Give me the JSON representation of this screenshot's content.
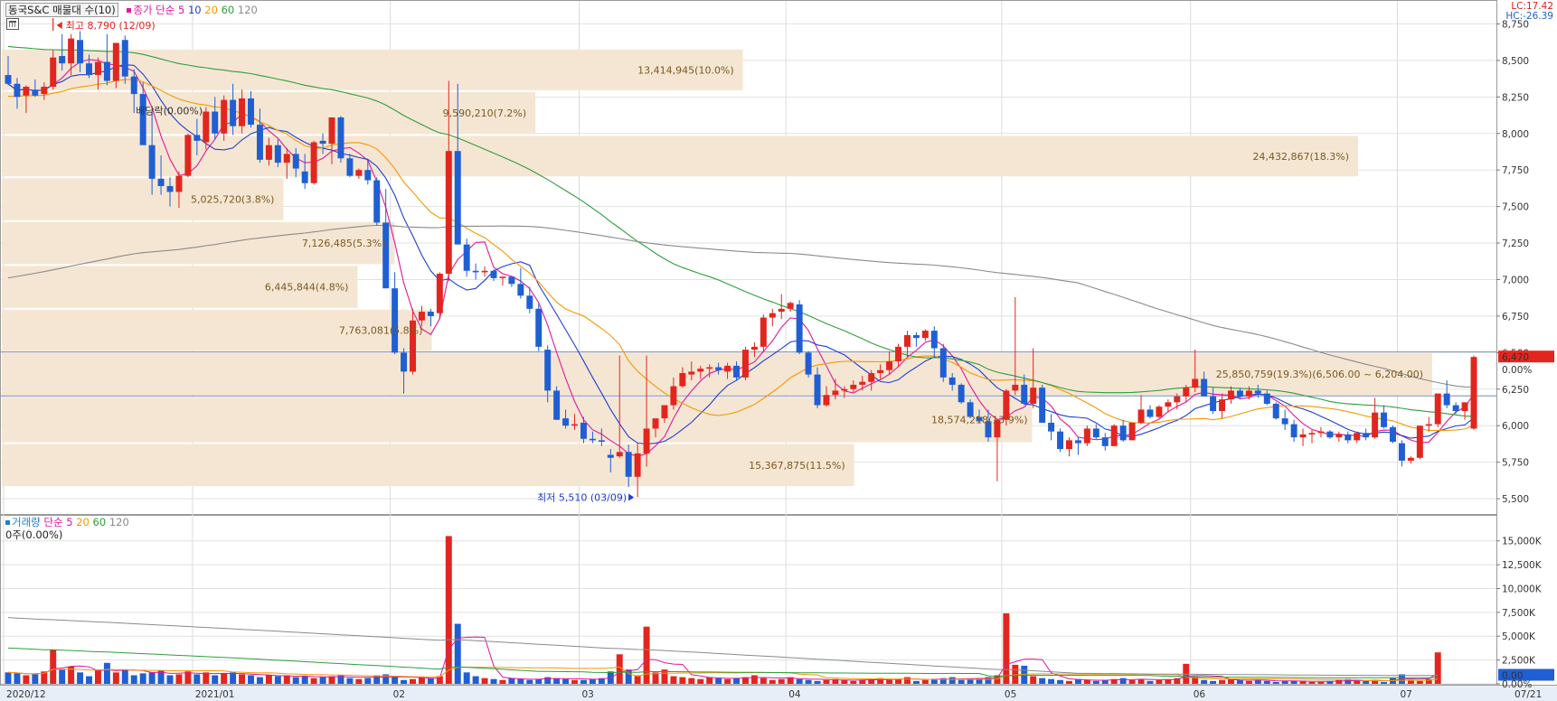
{
  "chart_data": [
    {
      "type": "candlestick",
      "title": "동국S&C 매물대 수(10)",
      "legend_ma": {
        "prefix": "종가 단순",
        "items": [
          {
            "period": "5",
            "color": "#e0179c"
          },
          {
            "period": "10",
            "color": "#1f3fd1"
          },
          {
            "period": "20",
            "color": "#f29a00"
          },
          {
            "period": "60",
            "color": "#2e9e3e"
          },
          {
            "period": "120",
            "color": "#8a8a8a"
          }
        ]
      },
      "corner_labels": {
        "lc": "LC:17.42",
        "hc": "HC:-26.39"
      },
      "ylim": [
        5420,
        8790
      ],
      "yticks": [
        "5,500",
        "5,750",
        "6,000",
        "6,250",
        "6,500",
        "6,750",
        "7,000",
        "7,250",
        "7,500",
        "7,750",
        "8,000",
        "8,250",
        "8,500",
        "8,750"
      ],
      "ytick_values": [
        5500,
        5750,
        6000,
        6250,
        6500,
        6750,
        7000,
        7250,
        7500,
        7750,
        8000,
        8250,
        8500,
        8750
      ],
      "price_tag": "6,470",
      "price_tag_pct": "0.00%",
      "high_label": "최고 8,790 (12/09)",
      "low_label": "최저 5,510 (03/09)",
      "ex_div_label": "배당락(0.00%)",
      "volume_profile": [
        {
          "label": "15,367,875(11.5%)",
          "lo": 5580,
          "hi": 5880,
          "pct": 11.5
        },
        {
          "label": "25,850,759(19.3%)(6,506.00 ~ 6,204.00)",
          "lo": 6204,
          "hi": 6506,
          "pct": 19.3
        },
        {
          "label": "",
          "lo": 5880,
          "hi": 6204,
          "pct": 13.9
        },
        {
          "label": "7,763,081(5.8%)",
          "lo": 6506,
          "hi": 6800,
          "pct": 5.8
        },
        {
          "label": "6,445,844(4.8%)",
          "lo": 6800,
          "hi": 7100,
          "pct": 4.8
        },
        {
          "label": "7,126,485(5.3%)",
          "lo": 7100,
          "hi": 7400,
          "pct": 5.3
        },
        {
          "label": "5,025,720(3.8%)",
          "lo": 7400,
          "hi": 7700,
          "pct": 3.8
        },
        {
          "label": "24,432,867(18.3%)",
          "lo": 7700,
          "hi": 7990,
          "pct": 18.3
        },
        {
          "label": "9,590,210(7.2%)",
          "lo": 7990,
          "hi": 8290,
          "pct": 7.2
        },
        {
          "label": "13,414,945(10.0%)",
          "lo": 8290,
          "hi": 8580,
          "pct": 10.0
        }
      ],
      "profile_mid_label": "18,574,218(13.9%)",
      "hlines": [
        6506,
        6204
      ],
      "series_candles": [
        [
          8400,
          8530,
          8330,
          8340
        ],
        [
          8340,
          8380,
          8170,
          8250
        ],
        [
          8260,
          8330,
          8140,
          8320
        ],
        [
          8300,
          8370,
          8250,
          8260
        ],
        [
          8270,
          8350,
          8230,
          8320
        ],
        [
          8320,
          8570,
          8300,
          8520
        ],
        [
          8530,
          8680,
          8430,
          8480
        ],
        [
          8480,
          8680,
          8400,
          8650
        ],
        [
          8640,
          8700,
          8420,
          8480
        ],
        [
          8480,
          8540,
          8380,
          8400
        ],
        [
          8400,
          8520,
          8300,
          8490
        ],
        [
          8490,
          8680,
          8330,
          8360
        ],
        [
          8360,
          8560,
          8310,
          8620
        ],
        [
          8640,
          8670,
          8340,
          8390
        ],
        [
          8390,
          8440,
          8140,
          8270
        ],
        [
          8270,
          8350,
          8050,
          7920
        ],
        [
          7920,
          8160,
          7580,
          7690
        ],
        [
          7690,
          7850,
          7580,
          7640
        ],
        [
          7640,
          7700,
          7500,
          7600
        ],
        [
          7600,
          7740,
          7490,
          7710
        ],
        [
          7710,
          8000,
          7700,
          7990
        ],
        [
          7990,
          8100,
          7850,
          7950
        ],
        [
          7940,
          8180,
          7890,
          8150
        ],
        [
          8150,
          8250,
          7960,
          8000
        ],
        [
          8000,
          8260,
          7950,
          8230
        ],
        [
          8230,
          8340,
          7990,
          8050
        ],
        [
          8050,
          8300,
          8000,
          8240
        ],
        [
          8240,
          8290,
          8040,
          8060
        ],
        [
          8060,
          8170,
          7800,
          7820
        ],
        [
          7820,
          7970,
          7780,
          7920
        ],
        [
          7920,
          7960,
          7770,
          7800
        ],
        [
          7800,
          7900,
          7690,
          7860
        ],
        [
          7860,
          7900,
          7700,
          7760
        ],
        [
          7740,
          7860,
          7620,
          7660
        ],
        [
          7660,
          7950,
          7650,
          7940
        ],
        [
          7950,
          8000,
          7860,
          7930
        ],
        [
          7930,
          8110,
          7790,
          8110
        ],
        [
          8110,
          8120,
          7800,
          7830
        ],
        [
          7830,
          7860,
          7700,
          7710
        ],
        [
          7710,
          7760,
          7690,
          7750
        ],
        [
          7750,
          7820,
          7650,
          7680
        ],
        [
          7680,
          7700,
          7370,
          7390
        ],
        [
          7390,
          7620,
          6940,
          6940
        ],
        [
          6940,
          7050,
          6490,
          6500
        ],
        [
          6500,
          6530,
          6220,
          6370
        ],
        [
          6370,
          6800,
          6350,
          6720
        ],
        [
          6720,
          6820,
          6680,
          6780
        ],
        [
          6780,
          6800,
          6680,
          6750
        ],
        [
          6770,
          7050,
          6730,
          7040
        ],
        [
          7040,
          8360,
          6990,
          7880
        ],
        [
          7880,
          8340,
          7520,
          7240
        ],
        [
          7240,
          7280,
          7020,
          7060
        ],
        [
          7060,
          7110,
          7000,
          7050
        ],
        [
          7050,
          7090,
          7020,
          7060
        ],
        [
          7060,
          7070,
          6990,
          7010
        ],
        [
          7010,
          7020,
          6960,
          7020
        ],
        [
          7020,
          7020,
          6950,
          6970
        ],
        [
          6970,
          7080,
          6870,
          6890
        ],
        [
          6890,
          6950,
          6770,
          6800
        ],
        [
          6800,
          6840,
          6510,
          6540
        ],
        [
          6520,
          6550,
          6160,
          6240
        ],
        [
          6240,
          6270,
          6040,
          6040
        ],
        [
          6050,
          6110,
          5980,
          6000
        ],
        [
          6000,
          6080,
          5970,
          6010
        ],
        [
          6020,
          6060,
          5880,
          5910
        ],
        [
          5910,
          5960,
          5880,
          5900
        ],
        [
          5900,
          5980,
          5860,
          5890
        ],
        [
          5800,
          5840,
          5680,
          5780
        ],
        [
          5790,
          6480,
          5780,
          5820
        ],
        [
          5820,
          5870,
          5580,
          5650
        ],
        [
          5650,
          5880,
          5510,
          5810
        ],
        [
          5810,
          6480,
          5720,
          5980
        ],
        [
          5980,
          6040,
          5920,
          6050
        ],
        [
          6050,
          6130,
          6020,
          6140
        ],
        [
          6140,
          6330,
          6110,
          6270
        ],
        [
          6270,
          6400,
          6260,
          6360
        ],
        [
          6350,
          6440,
          6310,
          6370
        ],
        [
          6370,
          6410,
          6320,
          6390
        ],
        [
          6390,
          6420,
          6330,
          6400
        ],
        [
          6400,
          6430,
          6350,
          6380
        ],
        [
          6370,
          6430,
          6320,
          6410
        ],
        [
          6410,
          6440,
          6310,
          6330
        ],
        [
          6330,
          6540,
          6310,
          6520
        ],
        [
          6520,
          6570,
          6470,
          6540
        ],
        [
          6540,
          6760,
          6510,
          6740
        ],
        [
          6740,
          6800,
          6680,
          6770
        ],
        [
          6780,
          6900,
          6730,
          6800
        ],
        [
          6800,
          6850,
          6780,
          6840
        ],
        [
          6830,
          6860,
          6490,
          6500
        ],
        [
          6500,
          6510,
          6330,
          6350
        ],
        [
          6350,
          6400,
          6120,
          6140
        ],
        [
          6140,
          6270,
          6130,
          6210
        ],
        [
          6210,
          6320,
          6180,
          6240
        ],
        [
          6240,
          6270,
          6190,
          6250
        ],
        [
          6250,
          6310,
          6230,
          6280
        ],
        [
          6280,
          6340,
          6240,
          6300
        ],
        [
          6300,
          6380,
          6240,
          6360
        ],
        [
          6360,
          6420,
          6320,
          6380
        ],
        [
          6380,
          6510,
          6350,
          6440
        ],
        [
          6440,
          6560,
          6400,
          6540
        ],
        [
          6540,
          6650,
          6470,
          6620
        ],
        [
          6620,
          6640,
          6540,
          6600
        ],
        [
          6600,
          6660,
          6580,
          6650
        ],
        [
          6650,
          6680,
          6470,
          6530
        ],
        [
          6530,
          6560,
          6300,
          6330
        ],
        [
          6330,
          6360,
          6240,
          6280
        ],
        [
          6280,
          6290,
          6150,
          6160
        ],
        [
          6160,
          6180,
          6050,
          6060
        ],
        [
          6060,
          6110,
          6020,
          6030
        ],
        [
          6030,
          6110,
          5890,
          5920
        ],
        [
          5920,
          5940,
          5620,
          6040
        ],
        [
          6040,
          6250,
          6000,
          6240
        ],
        [
          6240,
          6880,
          6210,
          6280
        ],
        [
          6280,
          6350,
          6140,
          6150
        ],
        [
          6150,
          6530,
          6120,
          6260
        ],
        [
          6260,
          6280,
          6020,
          6020
        ],
        [
          6020,
          6080,
          5900,
          5960
        ],
        [
          5960,
          5980,
          5820,
          5840
        ],
        [
          5840,
          5920,
          5790,
          5900
        ],
        [
          5900,
          5920,
          5800,
          5880
        ],
        [
          5880,
          6000,
          5860,
          5980
        ],
        [
          5980,
          6010,
          5910,
          5920
        ],
        [
          5920,
          5950,
          5830,
          5860
        ],
        [
          5860,
          6010,
          5860,
          6000
        ],
        [
          6000,
          6040,
          5890,
          5900
        ],
        [
          5900,
          6020,
          5900,
          6020
        ],
        [
          6020,
          6210,
          6010,
          6110
        ],
        [
          6110,
          6140,
          6050,
          6060
        ],
        [
          6060,
          6140,
          6050,
          6130
        ],
        [
          6130,
          6180,
          6090,
          6160
        ],
        [
          6160,
          6220,
          6110,
          6200
        ],
        [
          6200,
          6280,
          6160,
          6260
        ],
        [
          6260,
          6520,
          6230,
          6320
        ],
        [
          6320,
          6370,
          6200,
          6200
        ],
        [
          6200,
          6260,
          6080,
          6100
        ],
        [
          6100,
          6220,
          6050,
          6180
        ],
        [
          6180,
          6270,
          6150,
          6240
        ],
        [
          6240,
          6260,
          6180,
          6200
        ],
        [
          6200,
          6270,
          6180,
          6240
        ],
        [
          6240,
          6280,
          6190,
          6220
        ],
        [
          6220,
          6240,
          6140,
          6150
        ],
        [
          6150,
          6160,
          6040,
          6050
        ],
        [
          6050,
          6110,
          5970,
          6010
        ],
        [
          6010,
          6040,
          5890,
          5920
        ],
        [
          5920,
          5980,
          5860,
          5940
        ],
        [
          5940,
          5970,
          5880,
          5950
        ],
        [
          5950,
          5990,
          5920,
          5960
        ],
        [
          5960,
          5970,
          5910,
          5920
        ],
        [
          5920,
          5960,
          5890,
          5940
        ],
        [
          5940,
          5960,
          5880,
          5900
        ],
        [
          5900,
          5960,
          5880,
          5950
        ],
        [
          5950,
          5980,
          5900,
          5920
        ],
        [
          5920,
          6190,
          5910,
          6090
        ],
        [
          6090,
          6140,
          5980,
          5990
        ],
        [
          5990,
          6000,
          5880,
          5890
        ],
        [
          5880,
          5900,
          5720,
          5760
        ],
        [
          5760,
          5790,
          5740,
          5780
        ],
        [
          5780,
          5990,
          5770,
          6000
        ],
        [
          6000,
          6060,
          5960,
          6010
        ],
        [
          6010,
          6090,
          5990,
          6220
        ],
        [
          6220,
          6310,
          6120,
          6140
        ],
        [
          6140,
          6160,
          6080,
          6100
        ],
        [
          6100,
          6120,
          6040,
          6160
        ],
        [
          5980,
          6480,
          5970,
          6470
        ]
      ],
      "volume_ylim": [
        0,
        16300
      ],
      "volume_yticks": [
        "0.00%",
        "2,500K",
        "5,000K",
        "7,500K",
        "10,000K",
        "12,500K",
        "15,000K"
      ],
      "volume_ytick_values": [
        0,
        2500,
        5000,
        7500,
        10000,
        12500,
        15000
      ],
      "volume_legend": {
        "title": "거래량",
        "prefix": "단순",
        "items": [
          {
            "period": "5",
            "color": "#e0179c"
          },
          {
            "period": "20",
            "color": "#f29a00"
          },
          {
            "period": "60",
            "color": "#2e9e3e"
          },
          {
            "period": "120",
            "color": "#8a8a8a"
          }
        ]
      },
      "volume_info": "0주(0.00%)",
      "volume_tag": "0.00",
      "volumes": [
        1200,
        1100,
        900,
        1000,
        1300,
        3600,
        1500,
        1800,
        1200,
        800,
        1500,
        2200,
        1200,
        1500,
        900,
        1100,
        1200,
        1400,
        900,
        1000,
        1300,
        1000,
        1200,
        900,
        1100,
        1200,
        1000,
        900,
        700,
        900,
        800,
        900,
        700,
        800,
        600,
        700,
        800,
        900,
        600,
        500,
        600,
        900,
        1000,
        700,
        400,
        500,
        700,
        600,
        800,
        15500,
        6300,
        1200,
        800,
        600,
        500,
        400,
        600,
        500,
        400,
        500,
        700,
        600,
        500,
        400,
        400,
        500,
        600,
        1300,
        3100,
        1500,
        900,
        6000,
        1200,
        1500,
        800,
        700,
        600,
        500,
        700,
        600,
        500,
        600,
        700,
        900,
        600,
        400,
        500,
        700,
        500,
        400,
        300,
        400,
        500,
        400,
        300,
        400,
        500,
        600,
        400,
        500,
        700,
        300,
        400,
        500,
        600,
        700,
        400,
        500,
        600,
        700,
        900,
        7400,
        2000,
        1900,
        800,
        600,
        500,
        400,
        300,
        500,
        400,
        300,
        400,
        500,
        600,
        400,
        500,
        300,
        400,
        500,
        600,
        2100,
        700,
        400,
        300,
        400,
        500,
        400,
        300,
        400,
        300,
        200,
        300,
        300,
        300,
        200,
        200,
        300,
        400,
        500,
        300,
        300,
        400,
        200,
        600,
        1000,
        400,
        300,
        500,
        3300
      ]
    }
  ],
  "x_labels": [
    "2020/12",
    "2021/01",
    "02",
    "03",
    "04",
    "05",
    "06",
    "07",
    "07/21"
  ],
  "x_label_idx": [
    0,
    21,
    43,
    64,
    87,
    111,
    132,
    155,
    -1
  ],
  "ui": {
    "calendar_icon": "calendar-icon"
  }
}
